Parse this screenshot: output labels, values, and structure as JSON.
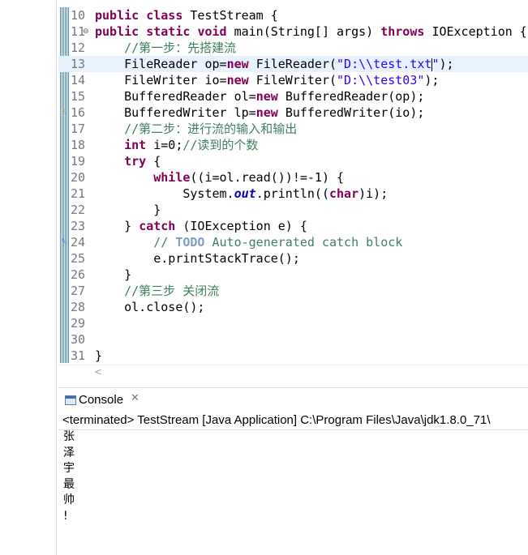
{
  "editor": {
    "lines": [
      {
        "num": "10",
        "tokens": [
          {
            "t": "public ",
            "c": "kw"
          },
          {
            "t": "class ",
            "c": "kw"
          },
          {
            "t": "TestStream {",
            "c": ""
          }
        ]
      },
      {
        "num": "11",
        "marker": "collapse",
        "tokens": [
          {
            "t": "public ",
            "c": "kw"
          },
          {
            "t": "static ",
            "c": "kw"
          },
          {
            "t": "void ",
            "c": "kw"
          },
          {
            "t": "main(String[] args) ",
            "c": ""
          },
          {
            "t": "throws ",
            "c": "kw"
          },
          {
            "t": "IOException {",
            "c": ""
          }
        ]
      },
      {
        "num": "12",
        "tokens": [
          {
            "t": "    ",
            "c": ""
          },
          {
            "t": "//第一步：先搭建流",
            "c": "cm"
          }
        ]
      },
      {
        "num": "13",
        "current": true,
        "tokens": [
          {
            "t": "    FileReader op=",
            "c": ""
          },
          {
            "t": "new ",
            "c": "kw"
          },
          {
            "t": "FileReader(",
            "c": ""
          },
          {
            "t": "\"D:\\\\test.txt",
            "c": "str"
          },
          {
            "t": "|",
            "c": "caret"
          },
          {
            "t": "\"",
            "c": "str"
          },
          {
            "t": ");",
            "c": ""
          }
        ]
      },
      {
        "num": "14",
        "tokens": [
          {
            "t": "    FileWriter io=",
            "c": ""
          },
          {
            "t": "new ",
            "c": "kw"
          },
          {
            "t": "FileWriter(",
            "c": ""
          },
          {
            "t": "\"D:\\\\test03\"",
            "c": "str"
          },
          {
            "t": ");",
            "c": ""
          }
        ]
      },
      {
        "num": "15",
        "tokens": [
          {
            "t": "    BufferedReader ol=",
            "c": ""
          },
          {
            "t": "new ",
            "c": "kw"
          },
          {
            "t": "BufferedReader(op);",
            "c": ""
          }
        ]
      },
      {
        "num": "16",
        "marker": "warning",
        "tokens": [
          {
            "t": "    BufferedWriter lp=",
            "c": ""
          },
          {
            "t": "new ",
            "c": "kw"
          },
          {
            "t": "BufferedWriter(io);",
            "c": ""
          }
        ]
      },
      {
        "num": "17",
        "tokens": [
          {
            "t": "    ",
            "c": ""
          },
          {
            "t": "//第二步：进行流的输入和输出",
            "c": "cm"
          }
        ]
      },
      {
        "num": "18",
        "tokens": [
          {
            "t": "    ",
            "c": ""
          },
          {
            "t": "int ",
            "c": "kw"
          },
          {
            "t": "i=0;",
            "c": ""
          },
          {
            "t": "//读到的个数",
            "c": "cm"
          }
        ]
      },
      {
        "num": "19",
        "tokens": [
          {
            "t": "    ",
            "c": ""
          },
          {
            "t": "try ",
            "c": "kw"
          },
          {
            "t": "{",
            "c": ""
          }
        ]
      },
      {
        "num": "20",
        "tokens": [
          {
            "t": "        ",
            "c": ""
          },
          {
            "t": "while",
            "c": "kw"
          },
          {
            "t": "((i=ol.read())!=-1) {",
            "c": ""
          }
        ]
      },
      {
        "num": "21",
        "tokens": [
          {
            "t": "            System.",
            "c": ""
          },
          {
            "t": "out",
            "c": "static-field"
          },
          {
            "t": ".println((",
            "c": ""
          },
          {
            "t": "char",
            "c": "kw"
          },
          {
            "t": ")i);",
            "c": ""
          }
        ]
      },
      {
        "num": "22",
        "tokens": [
          {
            "t": "        }",
            "c": ""
          }
        ]
      },
      {
        "num": "23",
        "tokens": [
          {
            "t": "    } ",
            "c": ""
          },
          {
            "t": "catch ",
            "c": "kw"
          },
          {
            "t": "(IOException e) {",
            "c": ""
          }
        ]
      },
      {
        "num": "24",
        "marker": "task",
        "tokens": [
          {
            "t": "        ",
            "c": ""
          },
          {
            "t": "// ",
            "c": "cm"
          },
          {
            "t": "TODO ",
            "c": "todo"
          },
          {
            "t": "Auto-generated catch block",
            "c": "cm"
          }
        ]
      },
      {
        "num": "25",
        "tokens": [
          {
            "t": "        e.printStackTrace();",
            "c": ""
          }
        ]
      },
      {
        "num": "26",
        "tokens": [
          {
            "t": "    }",
            "c": ""
          }
        ]
      },
      {
        "num": "27",
        "tokens": [
          {
            "t": "    ",
            "c": ""
          },
          {
            "t": "//第三步 关闭流",
            "c": "cm"
          }
        ]
      },
      {
        "num": "28",
        "tokens": [
          {
            "t": "    ol.close();",
            "c": ""
          }
        ]
      },
      {
        "num": "29",
        "tokens": []
      },
      {
        "num": "30",
        "tokens": []
      },
      {
        "num": "31",
        "tokens": [
          {
            "t": "}",
            "c": ""
          }
        ]
      }
    ]
  },
  "console": {
    "title": "Console",
    "close_icon": "✕",
    "status": "<terminated> TestStream [Java Application] C:\\Program Files\\Java\\jdk1.8.0_71\\",
    "output": [
      "张",
      "泽",
      "宇",
      "最",
      "帅",
      "!"
    ]
  },
  "colors": {
    "keyword": "#7f0055",
    "string": "#2a00ff",
    "comment": "#3f7f5f",
    "todo": "#7f9fbf",
    "static_field": "#0000c0",
    "current_line": "#e8f2fe"
  }
}
